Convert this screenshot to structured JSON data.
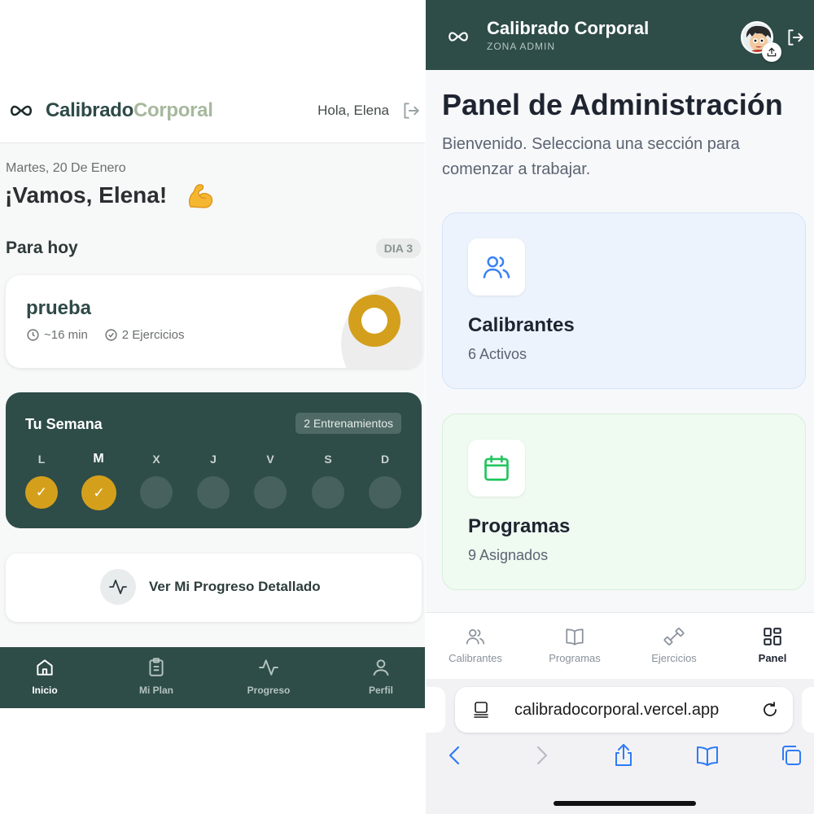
{
  "left": {
    "header": {
      "brand_part1": "Calibrado",
      "brand_part2": "Corporal",
      "greeting": "Hola, Elena"
    },
    "date": "Martes, 20 De Enero",
    "motivation": "¡Vamos, Elena!",
    "today": {
      "title": "Para hoy",
      "badge": "DIA 3",
      "workout_name": "prueba",
      "duration": "~16 min",
      "exercises": "2 Ejercicios"
    },
    "week": {
      "title": "Tu Semana",
      "badge": "2 Entrenamientos",
      "days": [
        {
          "label": "L",
          "done": true
        },
        {
          "label": "M",
          "done": true
        },
        {
          "label": "X",
          "done": false
        },
        {
          "label": "J",
          "done": false
        },
        {
          "label": "V",
          "done": false
        },
        {
          "label": "S",
          "done": false
        },
        {
          "label": "D",
          "done": false
        }
      ],
      "check": "✓"
    },
    "progress_button": "Ver Mi Progreso Detallado",
    "nav": {
      "inicio": "Inicio",
      "mi_plan": "Mi Plan",
      "progreso": "Progreso",
      "perfil": "Perfil",
      "active": "inicio"
    },
    "colors": {
      "primary": "#2e4c48",
      "accent": "#d4a01c",
      "brand_light": "#a7b89d"
    }
  },
  "right": {
    "header": {
      "title": "Calibrado Corporal",
      "subtitle": "ZONA ADMIN"
    },
    "page_title": "Panel de Administración",
    "lead": "Bienvenido. Selecciona una sección para comenzar a trabajar.",
    "cards": [
      {
        "title": "Calibrantes",
        "subtitle": "6 Activos",
        "icon": "users-icon",
        "color": "#3b82f6"
      },
      {
        "title": "Programas",
        "subtitle": "9 Asignados",
        "icon": "calendar-icon",
        "color": "#22c55e"
      }
    ],
    "tabbar": {
      "calibrantes": "Calibrantes",
      "programas": "Programas",
      "ejercicios": "Ejercicios",
      "panel": "Panel",
      "active": "panel"
    },
    "browser": {
      "url": "calibradocorporal.vercel.app"
    }
  }
}
